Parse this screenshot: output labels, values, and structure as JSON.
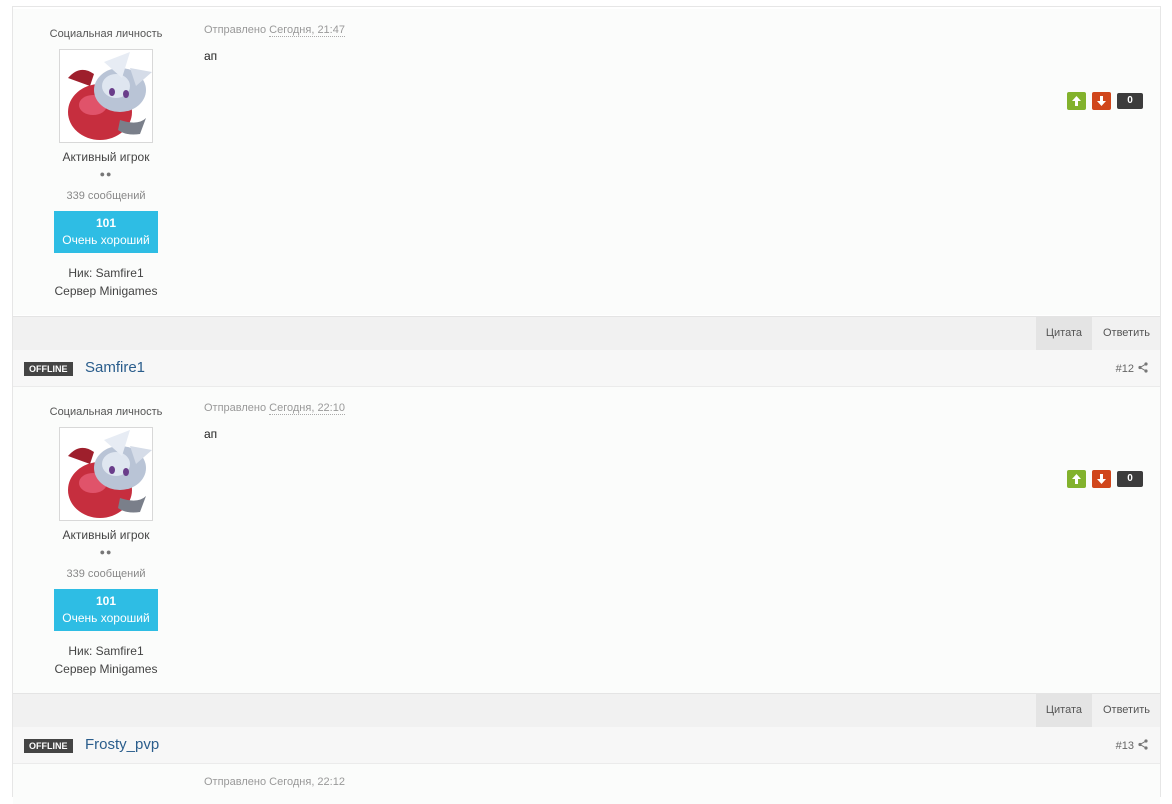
{
  "posts": [
    {
      "author_title": "Социальная личность",
      "rank": "Активный игрок",
      "pips": "●●",
      "post_count": "339 сообщений",
      "rep_value": "101",
      "rep_label": "Очень хороший",
      "nick": "Ник: Samfire1",
      "server": "Сервер Minigames",
      "meta_prefix": "Отправлено",
      "meta_date": "Сегодня, 21:47",
      "content": "ап",
      "vote_count": "0",
      "quote_label": "Цитата",
      "reply_label": "Ответить"
    },
    {
      "author_title": "Социальная личность",
      "rank": "Активный игрок",
      "pips": "●●",
      "post_count": "339 сообщений",
      "rep_value": "101",
      "rep_label": "Очень хороший",
      "nick": "Ник: Samfire1",
      "server": "Сервер Minigames",
      "meta_prefix": "Отправлено",
      "meta_date": "Сегодня, 22:10",
      "content": "ап",
      "vote_count": "0",
      "quote_label": "Цитата",
      "reply_label": "Ответить"
    }
  ],
  "author_bars": [
    {
      "status": "OFFLINE",
      "name": "Samfire1",
      "post_number": "#12"
    },
    {
      "status": "OFFLINE",
      "name": "Frosty_pvp",
      "post_number": "#13"
    }
  ],
  "next_post_meta": "Отправлено Сегодня, 22:12",
  "colors": {
    "rep_badge": "#2ebde4",
    "vote_up": "#82b22c",
    "vote_down": "#d0461b",
    "author_link": "#2a5d8c"
  },
  "icons": [
    "arrow-up-icon",
    "arrow-down-icon",
    "share-icon"
  ]
}
